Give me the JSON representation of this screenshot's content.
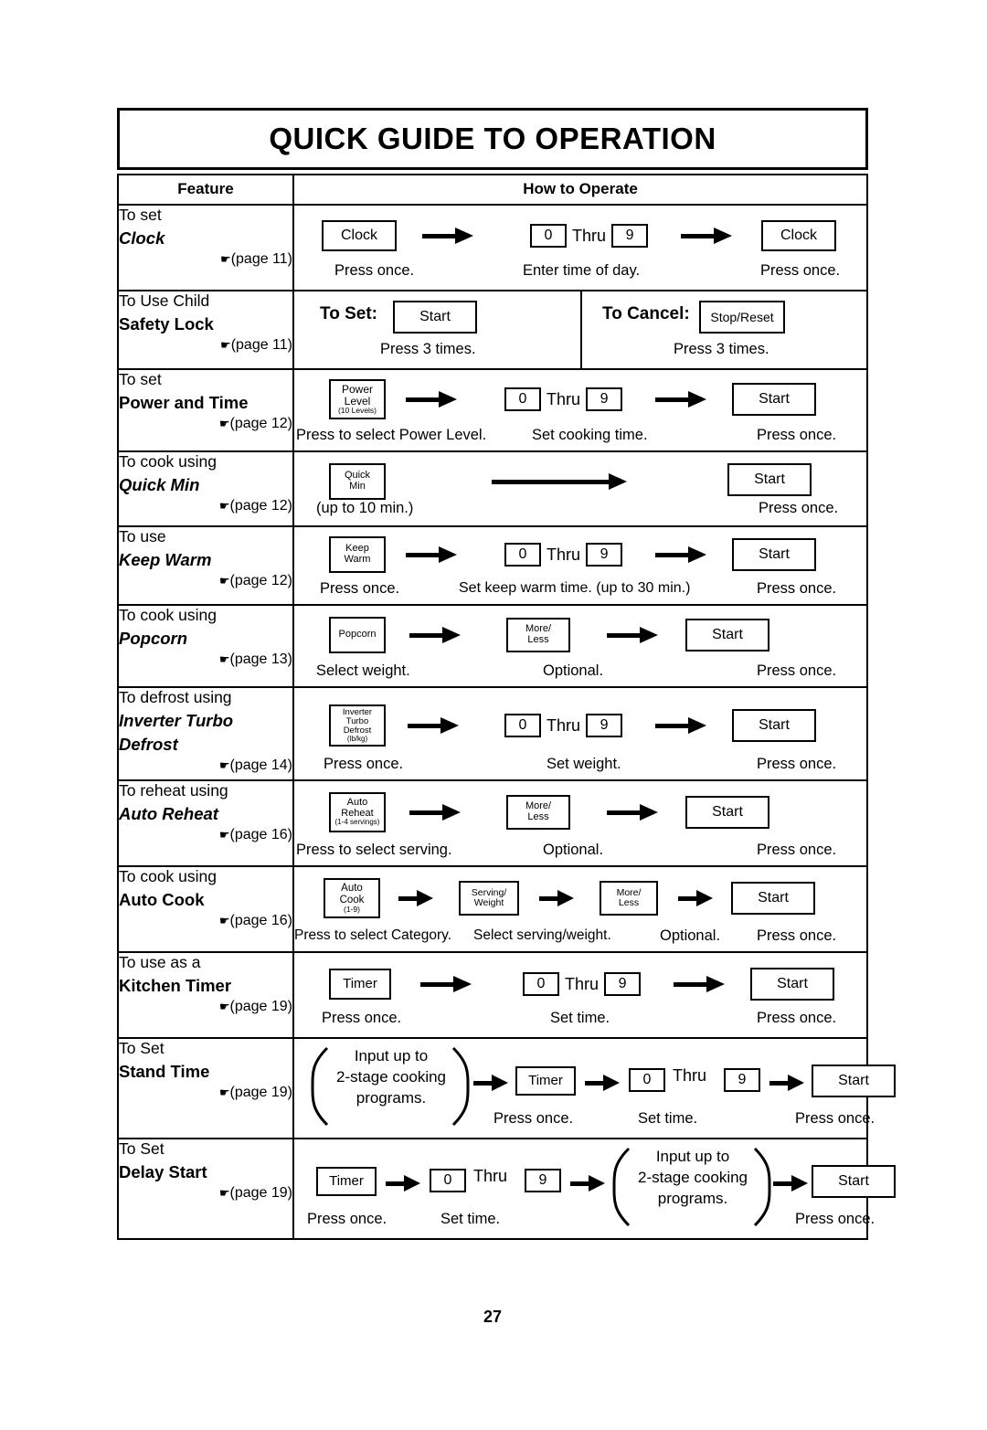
{
  "title": "QUICK GUIDE TO OPERATION",
  "page_number": "27",
  "headers": {
    "feature": "Feature",
    "how_to_operate": "How to Operate"
  },
  "labels": {
    "thru": "Thru",
    "zero": "0",
    "nine": "9",
    "press_once": "Press once.",
    "press_3_times": "Press 3 times.",
    "optional": "Optional.",
    "start": "Start",
    "timer": "Timer",
    "more_less_1": "More/",
    "more_less_2": "Less"
  },
  "rows": [
    {
      "feature": {
        "line1": "To set",
        "name": "Clock",
        "italic": true,
        "page": "(page 11)"
      },
      "keys": {
        "k1": "Clock",
        "k2": "Clock"
      },
      "captions": {
        "c1": "Press once.",
        "c2": "Enter time of day.",
        "c3": "Press once."
      }
    },
    {
      "feature": {
        "line1": "To Use Child",
        "name": "Safety Lock",
        "italic": false,
        "page": "(page 11)"
      },
      "set_label": "To Set:",
      "cancel_label": "To Cancel:",
      "keys": {
        "k1": "Start",
        "k2": "Stop/Reset"
      },
      "captions": {
        "c1": "Press 3 times.",
        "c2": "Press 3 times."
      }
    },
    {
      "feature": {
        "line1": "To set",
        "name": "Power and Time",
        "italic": false,
        "page": "(page 12)"
      },
      "keys": {
        "k1_l1": "Power",
        "k1_l2": "Level",
        "k1_l3": "(10 Levels)",
        "k2": "Start"
      },
      "captions": {
        "c1": "Press to select Power Level.",
        "c2": "Set cooking time.",
        "c3": "Press once."
      }
    },
    {
      "feature": {
        "line1": "To cook using",
        "name": "Quick Min",
        "italic": true,
        "page": "(page 12)"
      },
      "keys": {
        "k1_l1": "Quick",
        "k1_l2": "Min",
        "k2": "Start"
      },
      "captions": {
        "c1": "(up to 10 min.)",
        "c2": "Press once."
      }
    },
    {
      "feature": {
        "line1": "To use",
        "name": "Keep Warm",
        "italic": true,
        "page": "(page 12)"
      },
      "keys": {
        "k1_l1": "Keep",
        "k1_l2": "Warm",
        "k2": "Start"
      },
      "captions": {
        "c1": "Press once.",
        "c2": "Set keep warm time. (up to 30 min.)",
        "c3": "Press once."
      }
    },
    {
      "feature": {
        "line1": "To cook using",
        "name": "Popcorn",
        "italic": true,
        "page": "(page 13)"
      },
      "keys": {
        "k1": "Popcorn",
        "k2_l1": "More/",
        "k2_l2": "Less",
        "k3": "Start"
      },
      "captions": {
        "c1": "Select weight.",
        "c2": "Optional.",
        "c3": "Press once."
      }
    },
    {
      "feature": {
        "line1": "To defrost using",
        "name": "Inverter Turbo",
        "name2": "Defrost",
        "italic": true,
        "page": "(page 14)"
      },
      "keys": {
        "k1_l1": "Inverter",
        "k1_l2": "Turbo",
        "k1_l3": "Defrost",
        "k1_l4": "(lb/kg)",
        "k2": "Start"
      },
      "captions": {
        "c1": "Press once.",
        "c2": "Set weight.",
        "c3": "Press once."
      }
    },
    {
      "feature": {
        "line1": "To reheat using",
        "name": "Auto Reheat",
        "italic": true,
        "page": "(page 16)"
      },
      "keys": {
        "k1_l1": "Auto",
        "k1_l2": "Reheat",
        "k1_l3": "(1-4 servings)",
        "k2_l1": "More/",
        "k2_l2": "Less",
        "k3": "Start"
      },
      "captions": {
        "c1": "Press to select serving.",
        "c2": "Optional.",
        "c3": "Press once."
      }
    },
    {
      "feature": {
        "line1": "To cook using",
        "name": "Auto Cook",
        "italic": false,
        "page": "(page 16)"
      },
      "keys": {
        "k1_l1": "Auto",
        "k1_l2": "Cook",
        "k1_l3": "(1-9)",
        "k2_l1": "Serving/",
        "k2_l2": "Weight",
        "k3_l1": "More/",
        "k3_l2": "Less",
        "k4": "Start"
      },
      "captions": {
        "c1": "Press to select Category.",
        "c2": "Select serving/weight.",
        "c3": "Optional.",
        "c4": "Press once."
      }
    },
    {
      "feature": {
        "line1": "To use as a",
        "name": "Kitchen Timer",
        "italic": false,
        "page": "(page 19)"
      },
      "keys": {
        "k1": "Timer",
        "k2": "Start"
      },
      "captions": {
        "c1": "Press once.",
        "c2": "Set time.",
        "c3": "Press once."
      }
    },
    {
      "feature": {
        "line1": "To Set",
        "name": "Stand Time",
        "italic": false,
        "page": "(page 19)"
      },
      "brace_text_1": "Input up to",
      "brace_text_2": "2-stage cooking",
      "brace_text_3": "programs.",
      "keys": {
        "k1": "Timer",
        "k2": "Start"
      },
      "captions": {
        "c1": "Press once.",
        "c2": "Set time.",
        "c3": "Press once."
      }
    },
    {
      "feature": {
        "line1": "To Set",
        "name": "Delay Start",
        "italic": false,
        "page": "(page 19)"
      },
      "brace_text_1": "Input up to",
      "brace_text_2": "2-stage cooking",
      "brace_text_3": "programs.",
      "keys": {
        "k1": "Timer",
        "k2": "Start"
      },
      "captions": {
        "c1": "Press once.",
        "c2": "Set time.",
        "c3": "Press once."
      }
    }
  ]
}
